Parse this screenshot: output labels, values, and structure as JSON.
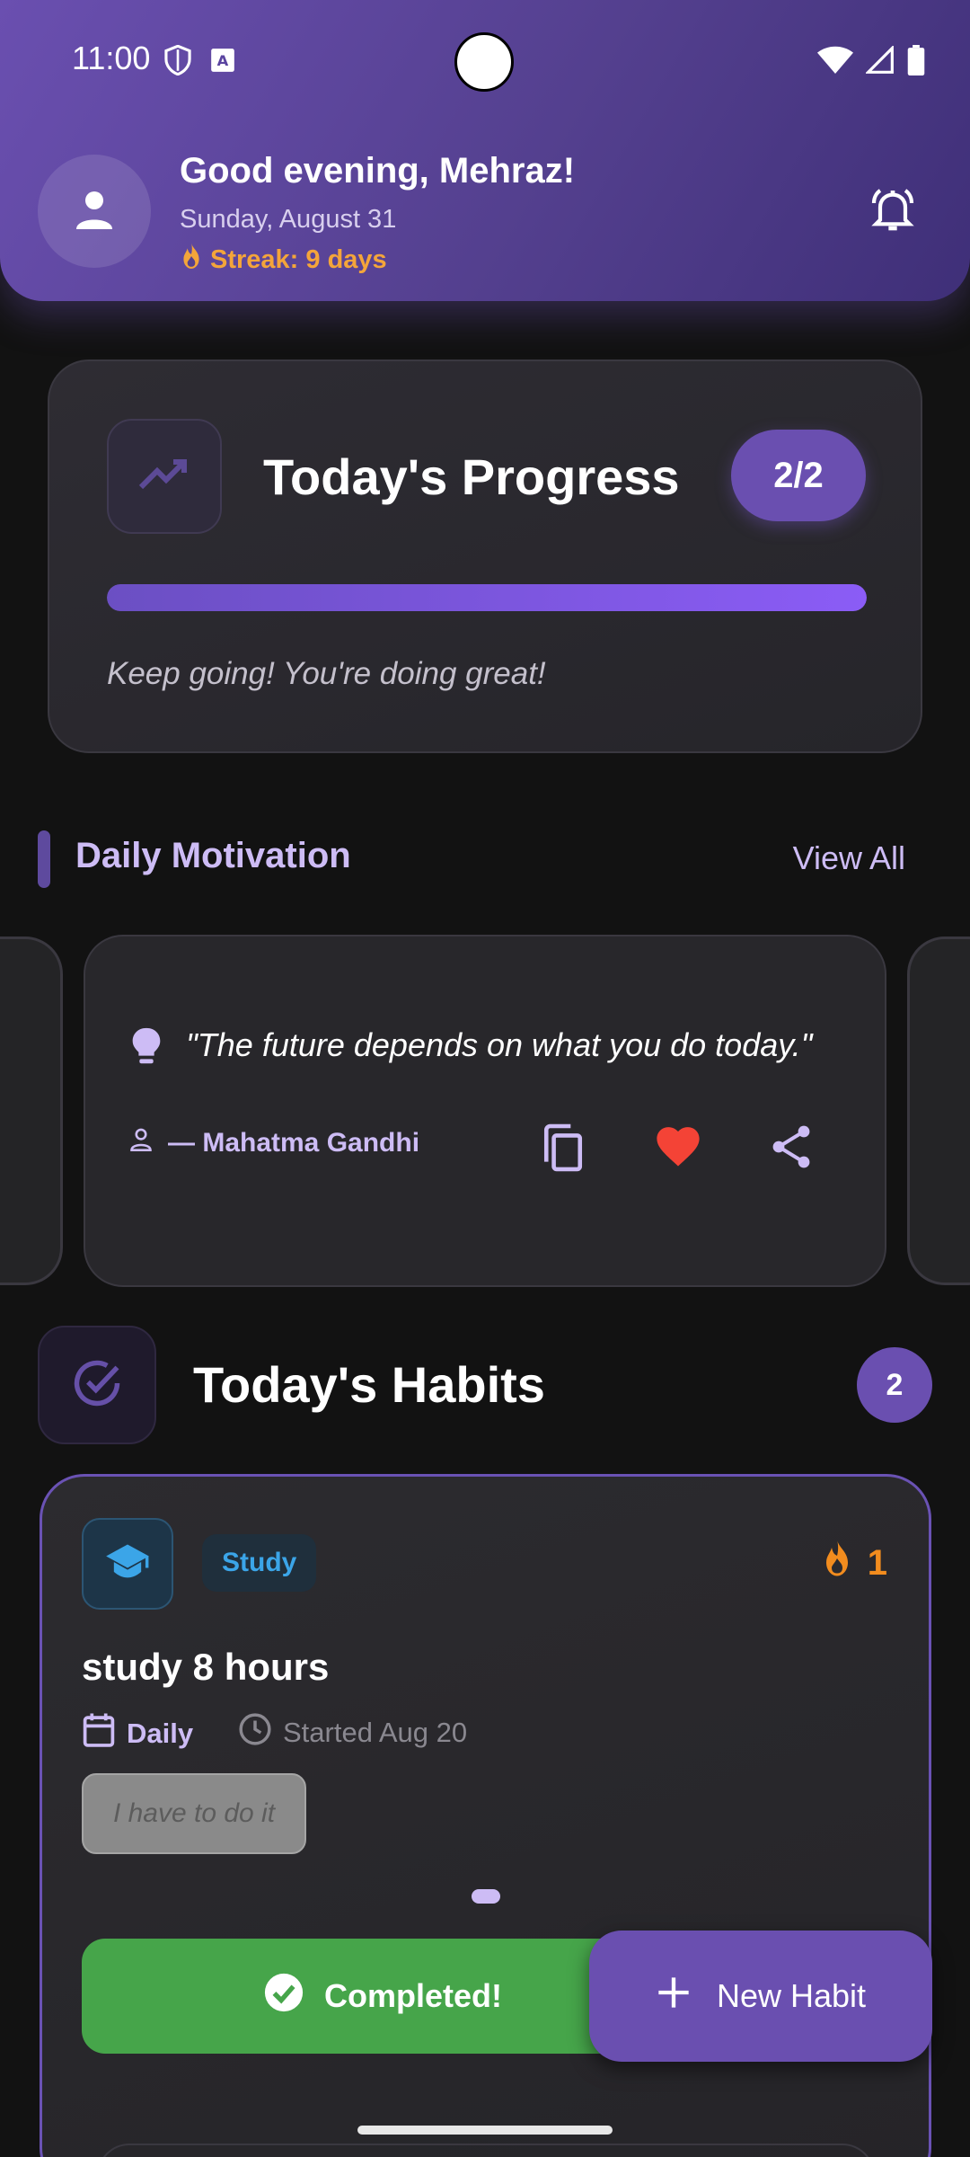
{
  "status_bar": {
    "time": "11:00"
  },
  "header": {
    "greeting": "Good evening, Mehraz!",
    "date": "Sunday, August 31",
    "streak": "Streak: 9 days"
  },
  "progress": {
    "title": "Today's Progress",
    "badge": "2/2",
    "completed": 2,
    "total": 2,
    "message": "Keep going! You're doing great!"
  },
  "motivation": {
    "section_title": "Daily Motivation",
    "view_all": "View All",
    "quote": "\"The future depends on what you do today.\"",
    "author": "— Mahatma Gandhi"
  },
  "habits": {
    "section_title": "Today's Habits",
    "count": "2",
    "items": [
      {
        "category": "Study",
        "streak": "1",
        "name": "study 8 hours",
        "frequency": "Daily",
        "started": "Started Aug 20",
        "note": "I have to do it",
        "status_label": "Completed!"
      }
    ]
  },
  "fab": {
    "label": "New Habit"
  },
  "colors": {
    "accent": "#6a4fb0",
    "accent_light": "#cdbcf5",
    "success": "#46a54a",
    "streak": "#f4a53a",
    "heart": "#f44336",
    "study": "#3ba5e8"
  },
  "icons": {
    "avatar": "person-icon",
    "bell": "bell-ring-icon",
    "progress": "trending-up-icon",
    "quote": "lightbulb-icon",
    "author": "person-outline-icon",
    "copy": "copy-icon",
    "favorite": "heart-icon",
    "share": "share-icon",
    "habits": "check-circle-icon",
    "category": "graduation-cap-icon",
    "fire": "fire-icon",
    "calendar": "calendar-icon",
    "clock": "clock-icon",
    "add": "plus-icon"
  }
}
